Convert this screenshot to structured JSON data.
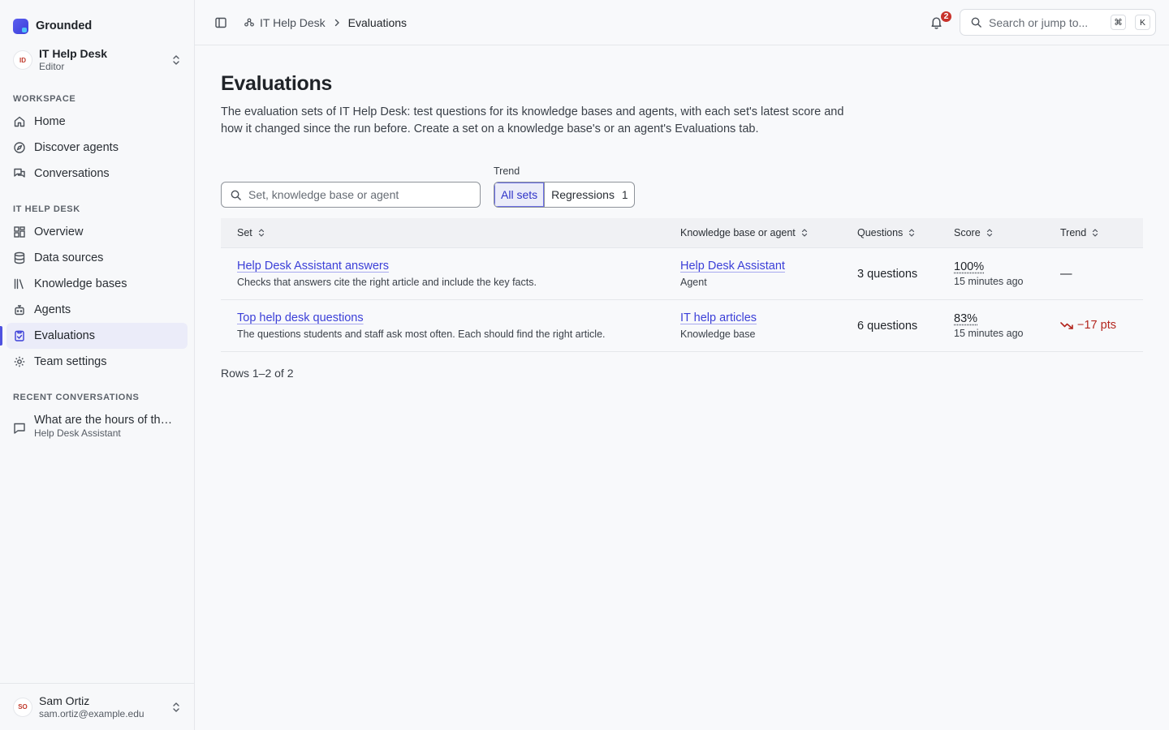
{
  "brand": {
    "name": "Grounded"
  },
  "team": {
    "initials": "ID",
    "name": "IT Help Desk",
    "role": "Editor"
  },
  "sections": {
    "workspace": "WORKSPACE",
    "team": "IT HELP DESK",
    "recent": "RECENT CONVERSATIONS"
  },
  "workspace_nav": [
    {
      "label": "Home",
      "icon": "home-icon"
    },
    {
      "label": "Discover agents",
      "icon": "compass-icon"
    },
    {
      "label": "Conversations",
      "icon": "chat-bubbles-icon"
    }
  ],
  "team_nav": [
    {
      "label": "Overview",
      "icon": "grid-icon"
    },
    {
      "label": "Data sources",
      "icon": "database-icon"
    },
    {
      "label": "Knowledge bases",
      "icon": "library-icon"
    },
    {
      "label": "Agents",
      "icon": "robot-icon"
    },
    {
      "label": "Evaluations",
      "icon": "clipboard-check-icon",
      "active": true
    },
    {
      "label": "Team settings",
      "icon": "gear-icon"
    }
  ],
  "recent": [
    {
      "title": "What are the hours of the IT help desk?",
      "sub": "Help Desk Assistant"
    }
  ],
  "user": {
    "initials": "SO",
    "name": "Sam Ortiz",
    "email": "sam.ortiz@example.edu"
  },
  "topbar": {
    "breadcrumb_team": "IT Help Desk",
    "breadcrumb_current": "Evaluations",
    "notifications": "2",
    "search_placeholder": "Search or jump to...",
    "kbd_1": "⌘",
    "kbd_2": "K"
  },
  "page": {
    "title": "Evaluations",
    "description": "The evaluation sets of IT Help Desk: test questions for its knowledge bases and agents, with each set's latest score and how it changed since the run before. Create a set on a knowledge base's or an agent's Evaluations tab."
  },
  "filters": {
    "search_placeholder": "Set, knowledge base or agent",
    "trend_label": "Trend",
    "all_sets": "All sets",
    "regressions": "Regressions",
    "regressions_count": "1"
  },
  "table": {
    "columns": [
      "Set",
      "Knowledge base or agent",
      "Questions",
      "Score",
      "Trend"
    ],
    "rows": [
      {
        "set": "Help Desk Assistant answers",
        "set_desc": "Checks that answers cite the right article and include the key facts.",
        "target": "Help Desk Assistant",
        "target_type": "Agent",
        "questions": "3 questions",
        "score": "100%",
        "score_time": "15 minutes ago",
        "trend": "—"
      },
      {
        "set": "Top help desk questions",
        "set_desc": "The questions students and staff ask most often. Each should find the right article.",
        "target": "IT help articles",
        "target_type": "Knowledge base",
        "questions": "6 questions",
        "score": "83%",
        "score_time": "15 minutes ago",
        "trend": "−17 pts"
      }
    ],
    "rows_count": "Rows 1–2 of 2"
  },
  "colors": {
    "accent": "#3b3fd8",
    "negative": "#b3261e",
    "badge": "#c8322b"
  }
}
